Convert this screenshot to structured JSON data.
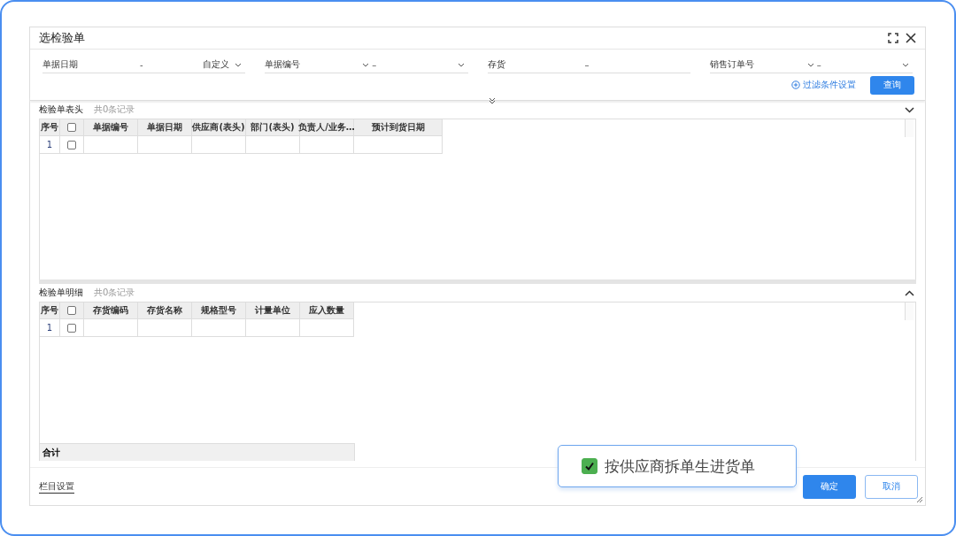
{
  "window": {
    "title": "选检验单"
  },
  "filters": [
    {
      "label": "单据日期",
      "kind": "date",
      "separator": "-",
      "mode": "自定义"
    },
    {
      "label": "单据编号",
      "kind": "range",
      "separator": "–"
    },
    {
      "label": "存货",
      "kind": "text",
      "separator": "–"
    },
    {
      "label": "销售订单号",
      "kind": "range",
      "separator": "–"
    }
  ],
  "filter_settings": "过滤条件设置",
  "query_button": "查询",
  "sections": [
    {
      "title": "检验单表头",
      "count": "共0条记录",
      "expanded": false,
      "columns": [
        "序号",
        "",
        "单据编号",
        "单据日期",
        "供应商(表头)",
        "部门(表头)",
        "负责人/业务…",
        "预计到货日期"
      ],
      "rows": [
        {
          "index": "1",
          "checked": false
        }
      ],
      "all_checked": false
    },
    {
      "title": "检验单明细",
      "count": "共0条记录",
      "expanded": true,
      "columns": [
        "序号",
        "",
        "存货编码",
        "存货名称",
        "规格型号",
        "计量单位",
        "应入数量"
      ],
      "rows": [
        {
          "index": "1",
          "checked": false
        }
      ],
      "all_checked": false,
      "total": "合计"
    }
  ],
  "column_settings": "栏目设置",
  "buttons": [
    {
      "label": "确定",
      "kind": "primary"
    },
    {
      "label": "取消",
      "kind": "secondary"
    }
  ],
  "callout": {
    "label": "按供应商拆单生进货单",
    "checked": true
  }
}
